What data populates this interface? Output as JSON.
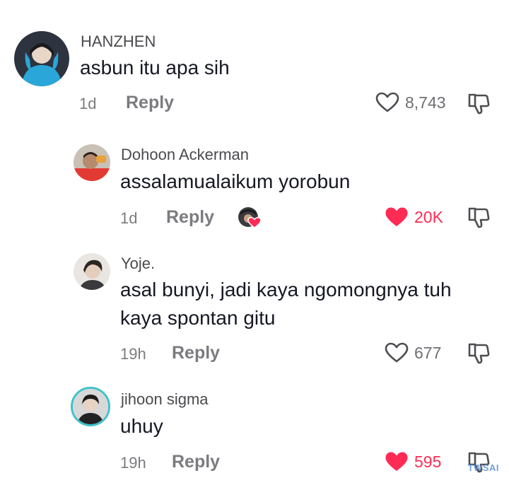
{
  "comments": [
    {
      "username": "HANZHEN",
      "text_lines": [
        "asbun itu apa sih"
      ],
      "time": "1d",
      "reply_label": "Reply",
      "like_count": "8,743",
      "liked": false
    },
    {
      "username": "Dohoon Ackerman",
      "text_lines": [
        "assalamualaikum yorobun"
      ],
      "time": "1d",
      "reply_label": "Reply",
      "like_count": "20K",
      "liked": true,
      "creator_liked": true
    },
    {
      "username": "Yoje.",
      "text_lines": [
        "asal bunyi, jadi kaya ngomongnya tuh",
        "kaya spontan gitu"
      ],
      "time": "19h",
      "reply_label": "Reply",
      "like_count": "677",
      "liked": false
    },
    {
      "username": "jihoon sigma",
      "text_lines": [
        "uhuy"
      ],
      "time": "19h",
      "reply_label": "Reply",
      "like_count": "595",
      "liked": true
    }
  ],
  "watermark": "TWSAI",
  "colors": {
    "liked": "#fe2c55",
    "muted": "#7b7b80",
    "avatar_ring": "#3fc3c9"
  },
  "icons": [
    "heart-outline-icon",
    "heart-filled-icon",
    "thumbs-down-icon"
  ]
}
